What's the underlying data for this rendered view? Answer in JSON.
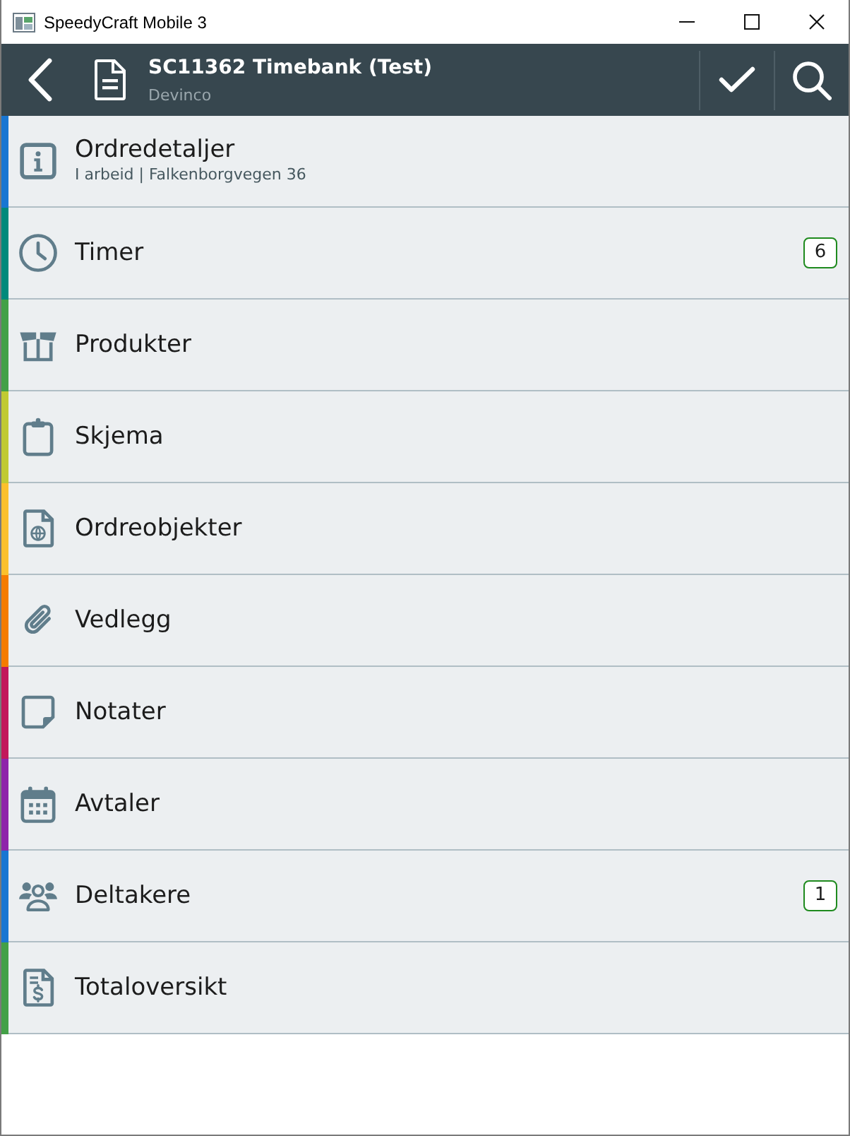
{
  "window": {
    "title": "SpeedyCraft Mobile 3"
  },
  "header": {
    "title": "SC11362 Timebank (Test)",
    "subtitle": "Devinco"
  },
  "menu": [
    {
      "label": "Ordredetaljer",
      "subtitle": "I arbeid | Falkenborgvegen 36",
      "color": "#1976d2"
    },
    {
      "label": "Timer",
      "badge": "6",
      "color": "#00897b"
    },
    {
      "label": "Produkter",
      "color": "#43a047"
    },
    {
      "label": "Skjema",
      "color": "#c0ca33"
    },
    {
      "label": "Ordreobjekter",
      "color": "#fbc02d"
    },
    {
      "label": "Vedlegg",
      "color": "#f57c00"
    },
    {
      "label": "Notater",
      "color": "#c2185b"
    },
    {
      "label": "Avtaler",
      "color": "#8e24aa"
    },
    {
      "label": "Deltakere",
      "badge": "1",
      "color": "#1976d2"
    },
    {
      "label": "Totaloversikt",
      "color": "#43a047"
    }
  ]
}
